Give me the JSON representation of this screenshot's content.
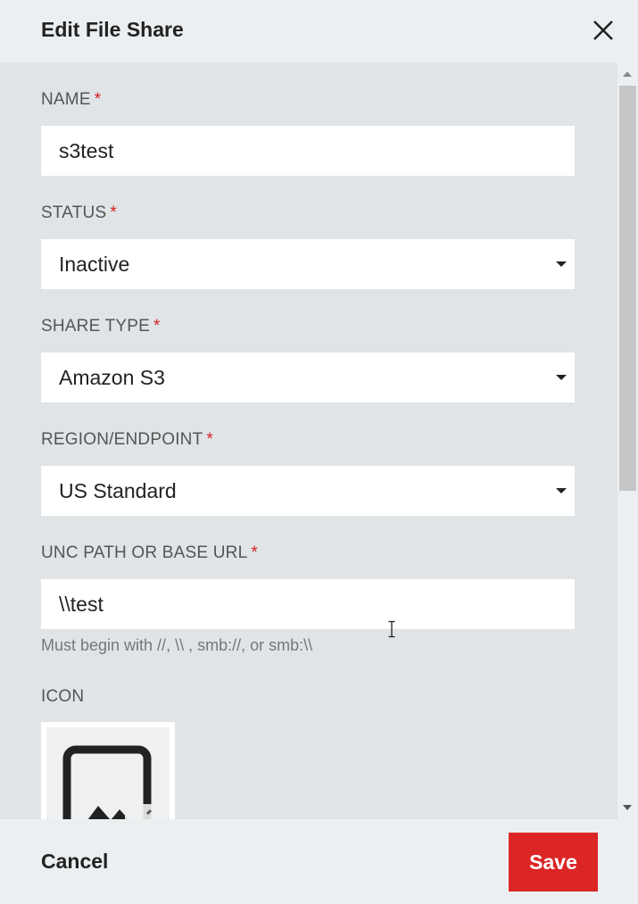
{
  "dialog": {
    "title": "Edit File Share",
    "close_icon": "close-icon"
  },
  "required_marker": "*",
  "fields": {
    "name": {
      "label": "NAME",
      "value": "s3test"
    },
    "status": {
      "label": "STATUS",
      "value": "Inactive"
    },
    "share_type": {
      "label": "SHARE TYPE",
      "value": "Amazon S3"
    },
    "region": {
      "label": "REGION/ENDPOINT",
      "value": "US Standard"
    },
    "unc_path": {
      "label": "UNC PATH OR BASE URL",
      "value": "\\\\test",
      "hint": "Must begin with //, \\\\ , smb://, or smb:\\\\"
    },
    "icon": {
      "label": "ICON",
      "icon_name": "image-placeholder-icon"
    }
  },
  "footer": {
    "cancel_label": "Cancel",
    "save_label": "Save"
  },
  "colors": {
    "accent": "#dc2626",
    "required": "#d32020",
    "body_bg": "#e0e4e7",
    "header_bg": "#eceff1"
  }
}
